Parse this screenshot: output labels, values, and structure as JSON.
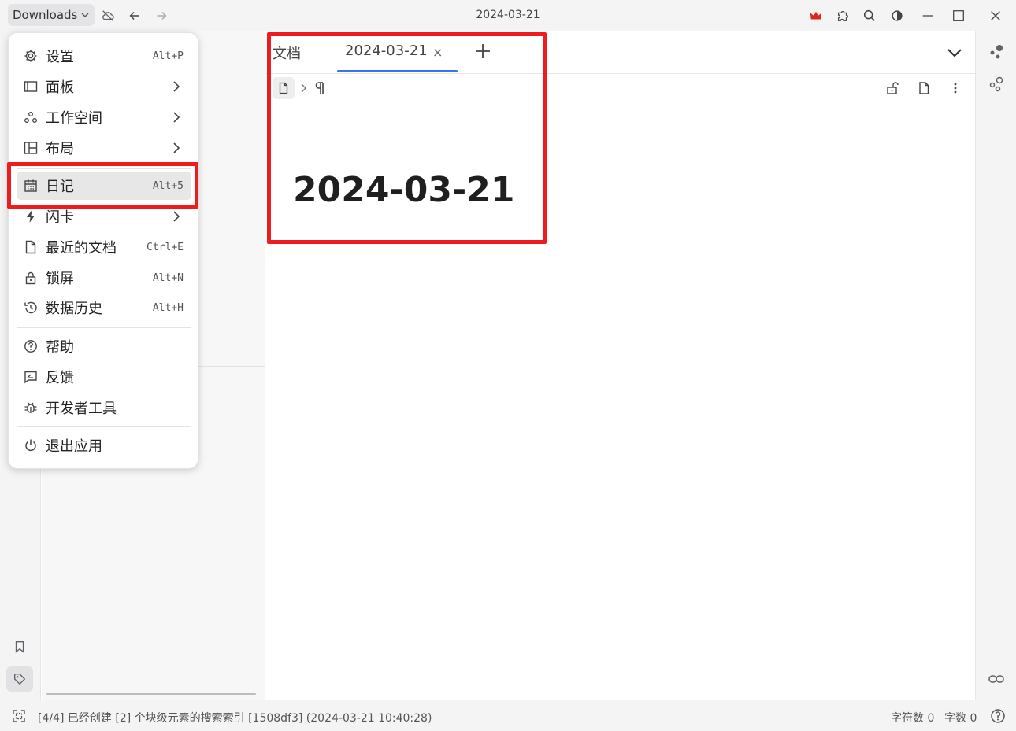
{
  "window": {
    "title": "2024-03-21",
    "workspace_label": "Downloads"
  },
  "editor": {
    "tabs": [
      {
        "label": "文档"
      },
      {
        "label": "2024-03-21",
        "active": true
      }
    ],
    "tab_close": "×",
    "doc_title": "2024-03-21"
  },
  "menu": {
    "items": [
      {
        "label": "设置",
        "shortcut": "Alt+P",
        "icon": "gear-icon"
      },
      {
        "label": "面板",
        "submenu": true,
        "icon": "panel-icon"
      },
      {
        "label": "工作空间",
        "submenu": true,
        "icon": "workspace-icon"
      },
      {
        "label": "布局",
        "submenu": true,
        "icon": "layout-icon"
      },
      {
        "label": "日记",
        "shortcut": "Alt+5",
        "icon": "calendar-icon",
        "active": true
      },
      {
        "label": "闪卡",
        "submenu": true,
        "icon": "bolt-icon"
      },
      {
        "label": "最近的文档",
        "shortcut": "Ctrl+E",
        "icon": "file-icon"
      },
      {
        "label": "锁屏",
        "shortcut": "Alt+N",
        "icon": "lock-icon"
      },
      {
        "label": "数据历史",
        "shortcut": "Alt+H",
        "icon": "history-icon"
      },
      {
        "label": "帮助",
        "icon": "help-icon"
      },
      {
        "label": "反馈",
        "icon": "feedback-icon"
      },
      {
        "label": "开发者工具",
        "icon": "bug-icon"
      },
      {
        "label": "退出应用",
        "icon": "power-icon"
      }
    ]
  },
  "statusbar": {
    "message": "[4/4] 已经创建 [2] 个块级元素的搜索索引 [1508df3] (2024-03-21 10:40:28)",
    "char_count": "字符数 0",
    "word_count": "字数 0"
  },
  "colors": {
    "accent": "#3575f0",
    "highlight": "#ee1c1c",
    "crown": "#e02424"
  }
}
